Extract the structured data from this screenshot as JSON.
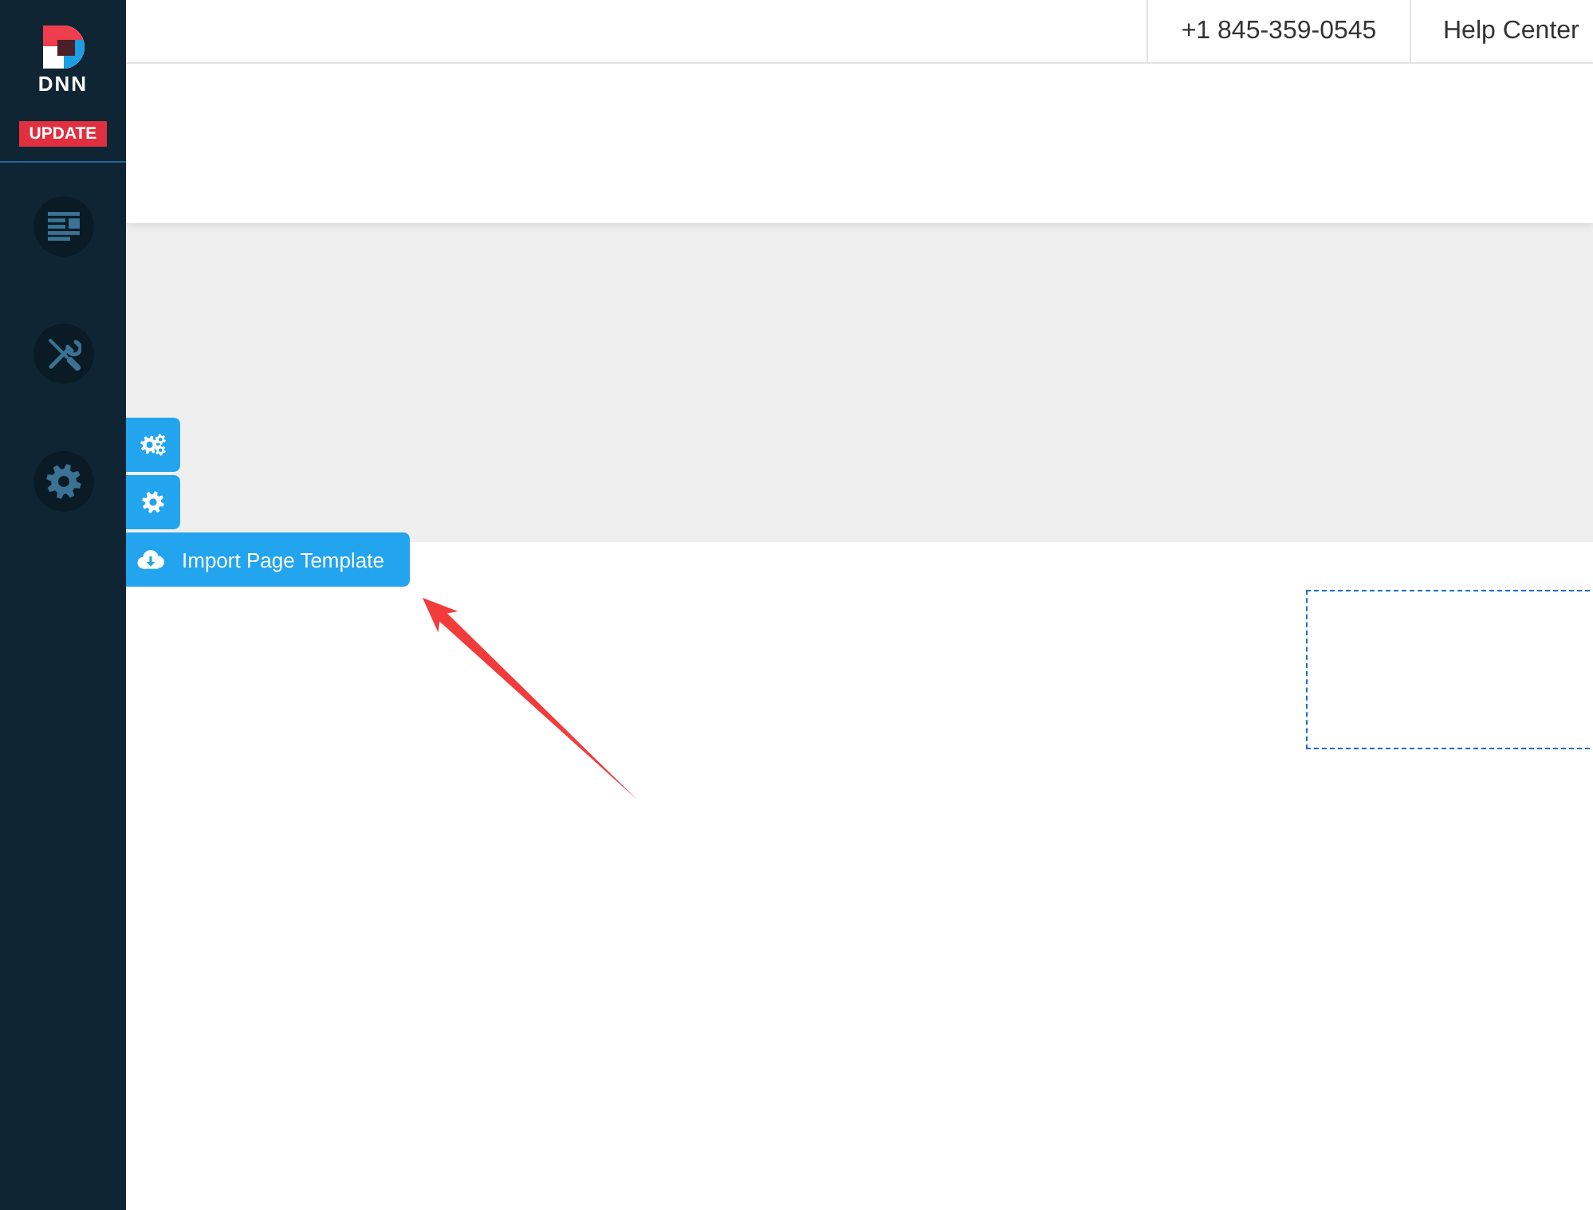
{
  "sidebar": {
    "logo_text": "DNN",
    "badge": "UPDATE",
    "items": [
      {
        "kind": "content"
      },
      {
        "kind": "tools"
      },
      {
        "kind": "settings"
      }
    ]
  },
  "top_bar": {
    "links": [
      "+1 845-359-0545",
      "Help Center"
    ]
  },
  "edit_toolbar": {
    "buttons": [
      {
        "kind": "module-settings"
      },
      {
        "kind": "page-settings"
      },
      {
        "kind": "import-template",
        "label": "Import Page Template"
      }
    ]
  }
}
